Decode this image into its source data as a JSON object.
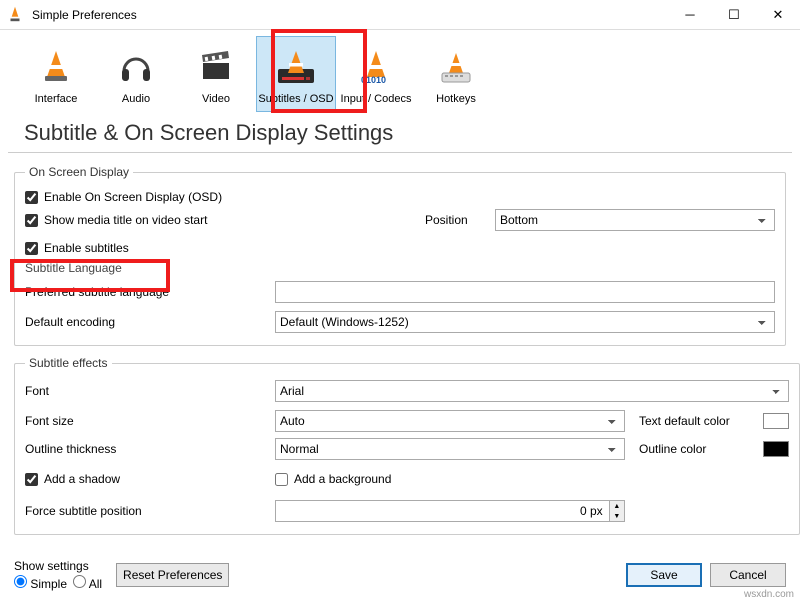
{
  "window": {
    "title": "Simple Preferences"
  },
  "tabs": {
    "interface": "Interface",
    "audio": "Audio",
    "video": "Video",
    "subtitles": "Subtitles / OSD",
    "codecs": "Input / Codecs",
    "hotkeys": "Hotkeys"
  },
  "heading": "Subtitle & On Screen Display Settings",
  "osd": {
    "legend": "On Screen Display",
    "enable_osd": "Enable On Screen Display (OSD)",
    "show_title": "Show media title on video start",
    "position_label": "Position",
    "position_value": "Bottom"
  },
  "sub": {
    "enable": "Enable subtitles",
    "lang_header": "Subtitle Language",
    "pref_lang_label": "Preferred subtitle language",
    "pref_lang_value": "",
    "enc_label": "Default encoding",
    "enc_value": "Default (Windows-1252)"
  },
  "fx": {
    "legend": "Subtitle effects",
    "font_label": "Font",
    "font_value": "Arial",
    "size_label": "Font size",
    "size_value": "Auto",
    "text_color_label": "Text default color",
    "thick_label": "Outline thickness",
    "thick_value": "Normal",
    "outline_color_label": "Outline color",
    "shadow": "Add a shadow",
    "background": "Add a background",
    "force_label": "Force subtitle position",
    "force_value": "0 px"
  },
  "colors": {
    "text_default": "#ffffff",
    "outline": "#000000"
  },
  "bottom": {
    "show_settings": "Show settings",
    "simple": "Simple",
    "all": "All",
    "reset": "Reset Preferences",
    "save": "Save",
    "cancel": "Cancel"
  },
  "watermark": "wsxdn.com"
}
